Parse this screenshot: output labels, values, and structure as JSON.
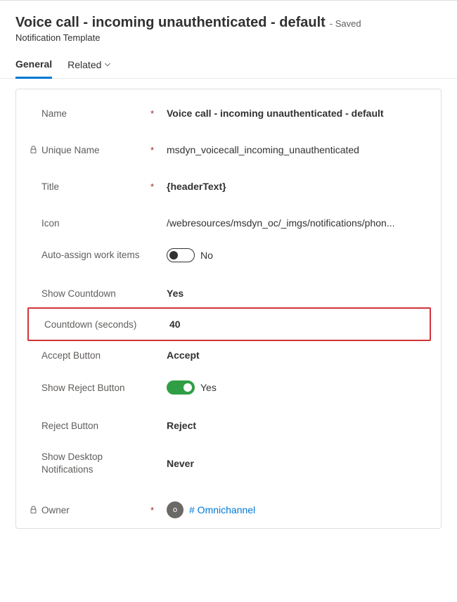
{
  "header": {
    "title": "Voice call - incoming unauthenticated - default",
    "status": "- Saved",
    "subtitle": "Notification Template"
  },
  "tabs": {
    "general": "General",
    "related": "Related"
  },
  "form": {
    "name": {
      "label": "Name",
      "value": "Voice call - incoming unauthenticated - default"
    },
    "uniqueName": {
      "label": "Unique Name",
      "value": "msdyn_voicecall_incoming_unauthenticated"
    },
    "title": {
      "label": "Title",
      "value": "{headerText}"
    },
    "icon": {
      "label": "Icon",
      "value": "/webresources/msdyn_oc/_imgs/notifications/phon..."
    },
    "autoAssign": {
      "label": "Auto-assign work items",
      "valueLabel": "No"
    },
    "showCountdown": {
      "label": "Show Countdown",
      "value": "Yes"
    },
    "countdownSeconds": {
      "label": "Countdown (seconds)",
      "value": "40"
    },
    "acceptButton": {
      "label": "Accept Button",
      "value": "Accept"
    },
    "showRejectButton": {
      "label": "Show Reject Button",
      "valueLabel": "Yes"
    },
    "rejectButton": {
      "label": "Reject Button",
      "value": "Reject"
    },
    "showDesktop": {
      "label": "Show Desktop Notifications",
      "value": "Never"
    },
    "owner": {
      "label": "Owner",
      "avatarInitial": "o",
      "linkText": "# Omnichannel"
    }
  }
}
